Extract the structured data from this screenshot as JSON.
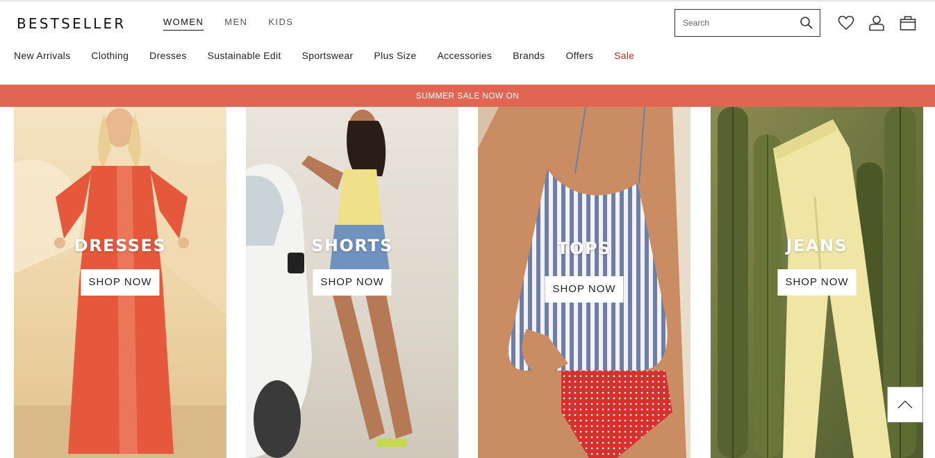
{
  "brand": {
    "logo": "BESTSELLER"
  },
  "gender_tabs": [
    {
      "label": "WOMEN",
      "active": true
    },
    {
      "label": "MEN",
      "active": false
    },
    {
      "label": "KIDS",
      "active": false
    }
  ],
  "search": {
    "placeholder": "Search",
    "value": ""
  },
  "header_icons": [
    "heart-icon",
    "user-icon",
    "shopping-bag-icon"
  ],
  "categories": [
    {
      "label": "New Arrivals"
    },
    {
      "label": "Clothing"
    },
    {
      "label": "Dresses"
    },
    {
      "label": "Sustainable Edit"
    },
    {
      "label": "Sportswear"
    },
    {
      "label": "Plus Size"
    },
    {
      "label": "Accessories"
    },
    {
      "label": "Brands"
    },
    {
      "label": "Offers"
    },
    {
      "label": "Sale",
      "highlight": "#b5301e"
    }
  ],
  "banner": {
    "text": "SUMMER SALE NOW ON",
    "color": "#e06653"
  },
  "tiles": [
    {
      "title": "DRESSES",
      "cta": "SHOP NOW"
    },
    {
      "title": "SHORTS",
      "cta": "SHOP NOW"
    },
    {
      "title": "TOPS",
      "cta": "SHOP NOW"
    },
    {
      "title": "JEANS",
      "cta": "SHOP NOW"
    }
  ],
  "back_to_top": {
    "icon": "chevron-up-icon"
  }
}
